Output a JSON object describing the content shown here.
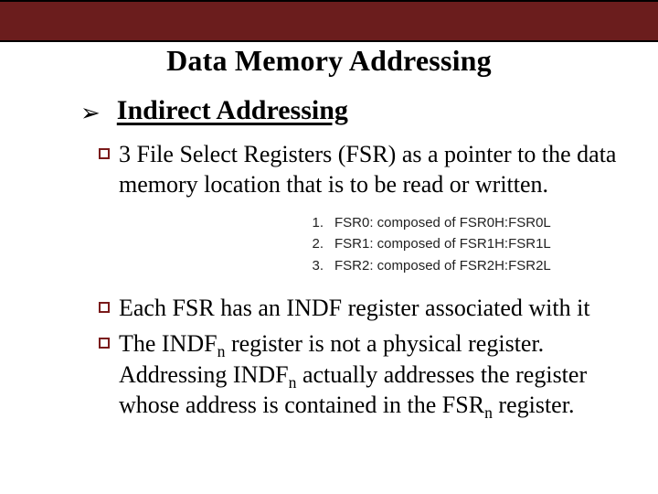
{
  "title": "Data Memory Addressing",
  "section": {
    "bullet_glyph": "➢",
    "heading": "Indirect Addressing"
  },
  "bullets": {
    "b1": "3 File Select Registers (FSR) as a pointer to the data memory location that is to be read or written.",
    "b2": "Each FSR has an INDF register associated with it",
    "b3_lead": "The INDF",
    "b3_sub1": "n",
    "b3_mid": " register is not a physical register. Addressing INDF",
    "b3_sub2": "n",
    "b3_mid2": " actually addresses the register whose address is contained in the FSR",
    "b3_sub3": "n",
    "b3_tail": " register."
  },
  "fsr": {
    "rows": [
      {
        "num": "1.",
        "text": "FSR0: composed of FSR0H:FSR0L"
      },
      {
        "num": "2.",
        "text": "FSR1: composed of FSR1H:FSR1L"
      },
      {
        "num": "3.",
        "text": "FSR2: composed of FSR2H:FSR2L"
      }
    ]
  }
}
